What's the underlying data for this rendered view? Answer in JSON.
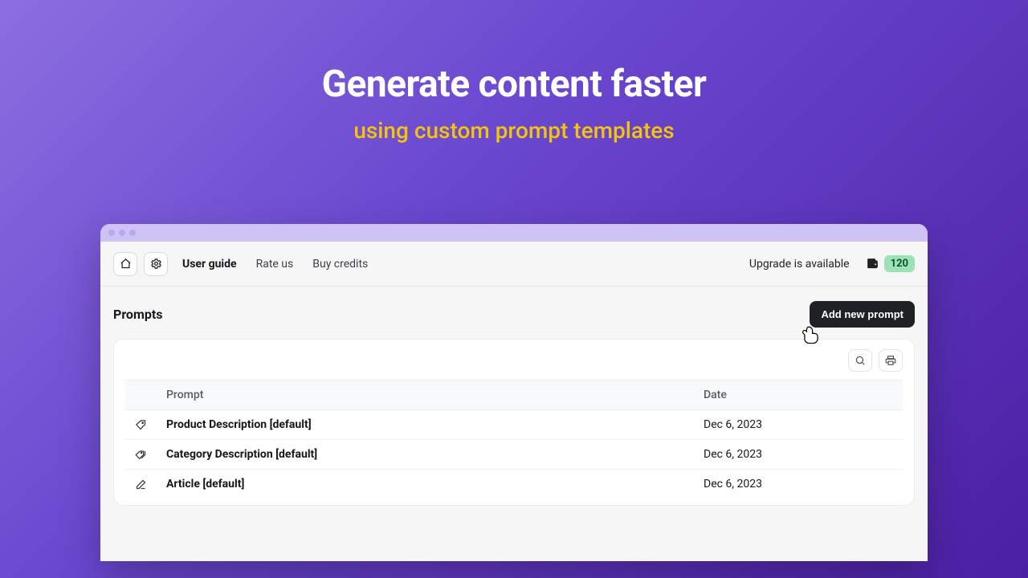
{
  "hero": {
    "title": "Generate content faster",
    "subtitle": "using custom prompt templates"
  },
  "topbar": {
    "nav": {
      "user_guide": "User guide",
      "rate_us": "Rate us",
      "buy_credits": "Buy credits"
    },
    "upgrade_text": "Upgrade is available",
    "credits": "120"
  },
  "section": {
    "title": "Prompts",
    "add_label": "Add new prompt"
  },
  "table": {
    "headers": {
      "prompt": "Prompt",
      "date": "Date"
    },
    "rows": [
      {
        "icon": "tag",
        "title": "Product Description [default]",
        "date": "Dec 6, 2023"
      },
      {
        "icon": "tags",
        "title": "Category Description [default]",
        "date": "Dec 6, 2023"
      },
      {
        "icon": "compose",
        "title": "Article [default]",
        "date": "Dec 6, 2023"
      }
    ]
  }
}
